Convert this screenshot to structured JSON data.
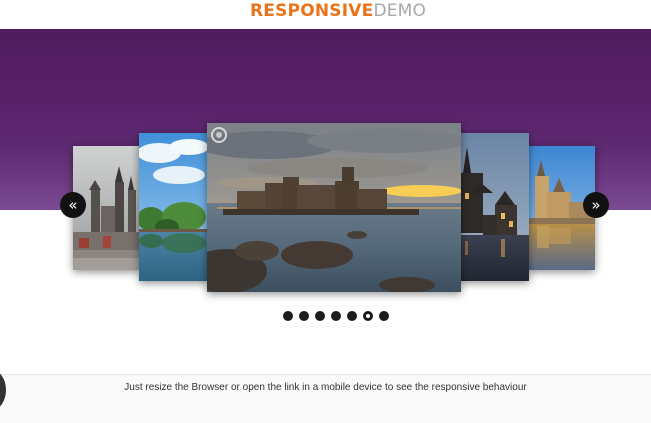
{
  "header": {
    "logo_strong": "RESPONSIVE",
    "logo_light": "DEMO"
  },
  "carousel": {
    "prev_label": "«",
    "next_label": "»",
    "slides": [
      {
        "name": "prague-castle-photo"
      },
      {
        "name": "lake-trees-photo"
      },
      {
        "name": "sea-castle-sunset-photo"
      },
      {
        "name": "lakeside-chateau-night-photo"
      },
      {
        "name": "waterfront-castle-photo"
      }
    ],
    "dot_count": 7,
    "active_dot": 5
  },
  "footer": {
    "text": "Just resize the Browser or open the link in a mobile device to see the responsive behaviour"
  },
  "colors": {
    "band_top": "#4f1d5e",
    "band_bottom": "#7a4a92",
    "logo_orange": "#e8741b",
    "logo_gray": "#a7a7a7"
  }
}
